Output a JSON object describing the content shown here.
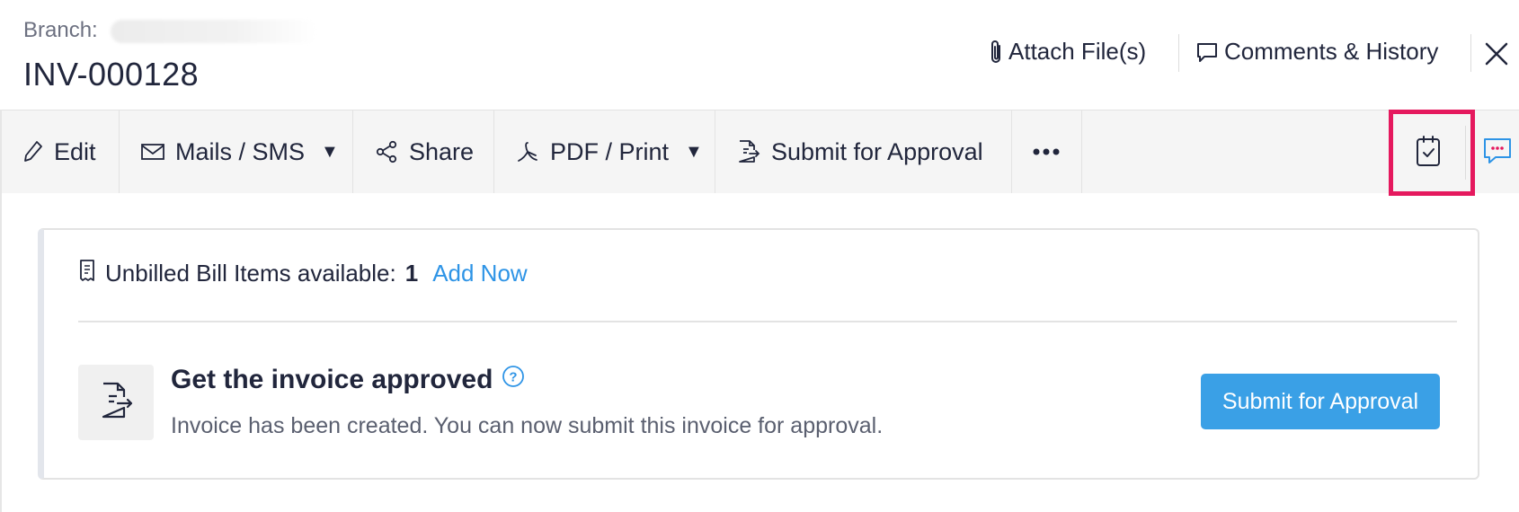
{
  "header": {
    "branch_label": "Branch:",
    "title": "INV-000128",
    "attach_label": "Attach File(s)",
    "comments_label": "Comments & History"
  },
  "toolbar": {
    "edit_label": "Edit",
    "mails_label": "Mails / SMS",
    "share_label": "Share",
    "pdf_label": "PDF / Print",
    "submit_label": "Submit for Approval"
  },
  "card": {
    "unbilled_label": "Unbilled Bill Items available:",
    "unbilled_count": "1",
    "add_now_label": "Add Now",
    "approve_title": "Get the invoice approved",
    "approve_desc": "Invoice has been created. You can now submit this invoice for approval.",
    "submit_button_label": "Submit for Approval"
  },
  "colors": {
    "accent_blue": "#3aa0e6",
    "link_blue": "#2e94e6",
    "highlight": "#e5195e",
    "toolbar_bg": "#f5f5f5"
  }
}
